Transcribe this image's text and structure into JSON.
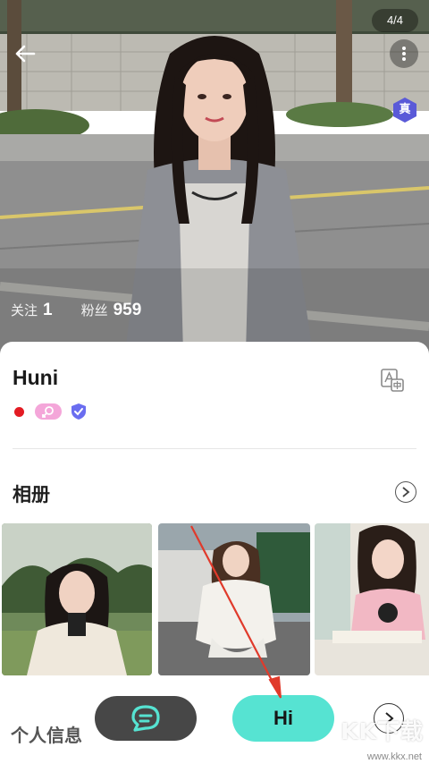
{
  "photo": {
    "counter": "4/4"
  },
  "stats": {
    "following_label": "关注",
    "following_count": "1",
    "fans_label": "粉丝",
    "fans_count": "959"
  },
  "badge": {
    "verified_text": "真"
  },
  "profile": {
    "username": "Huni"
  },
  "album": {
    "title": "相册",
    "photos": [
      "photo-1",
      "photo-2",
      "photo-3"
    ]
  },
  "info": {
    "title": "个人信息"
  },
  "actions": {
    "hi_label": "Hi"
  },
  "watermark": {
    "text": "KK下载",
    "url": "www.kkx.net"
  },
  "colors": {
    "accent": "#56e3d2",
    "chat_button": "#474747",
    "verified_badge": "#5a5ad8",
    "pink_tag": "#f4a6d9",
    "red_dot": "#e31b23"
  }
}
